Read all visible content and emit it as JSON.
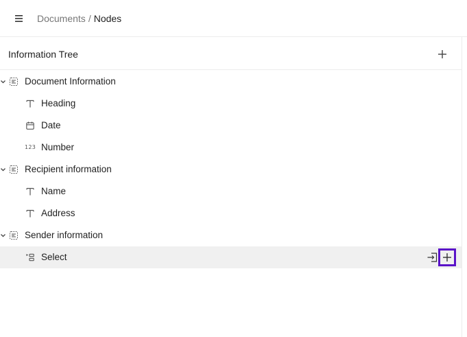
{
  "header": {
    "breadcrumb": {
      "parent": "Documents",
      "separator": "/",
      "current": "Nodes"
    },
    "icons": {
      "menu": "hamburger-menu-icon"
    }
  },
  "panel": {
    "title": "Information Tree",
    "add_icon": "plus-icon"
  },
  "tree": {
    "groups": [
      {
        "label": "Document Information",
        "icon": "section-group-icon",
        "expanded": true,
        "children": [
          {
            "label": "Heading",
            "icon": "text-type-icon"
          },
          {
            "label": "Date",
            "icon": "calendar-icon"
          },
          {
            "label": "Number",
            "icon": "number-type-icon",
            "glyph": "123"
          }
        ]
      },
      {
        "label": "Recipient information",
        "icon": "section-group-icon",
        "expanded": true,
        "children": [
          {
            "label": "Name",
            "icon": "text-type-icon"
          },
          {
            "label": "Address",
            "icon": "text-type-icon"
          }
        ]
      },
      {
        "label": "Sender information",
        "icon": "section-group-icon",
        "expanded": true,
        "children": [
          {
            "label": "Select",
            "icon": "select-type-icon",
            "hovered": true,
            "actions": [
              "move-into-icon",
              "plus-icon"
            ]
          }
        ]
      }
    ]
  },
  "colors": {
    "focus_outline": "#5a12c8",
    "row_hover": "#f0f0f0",
    "divider": "#ececec"
  }
}
